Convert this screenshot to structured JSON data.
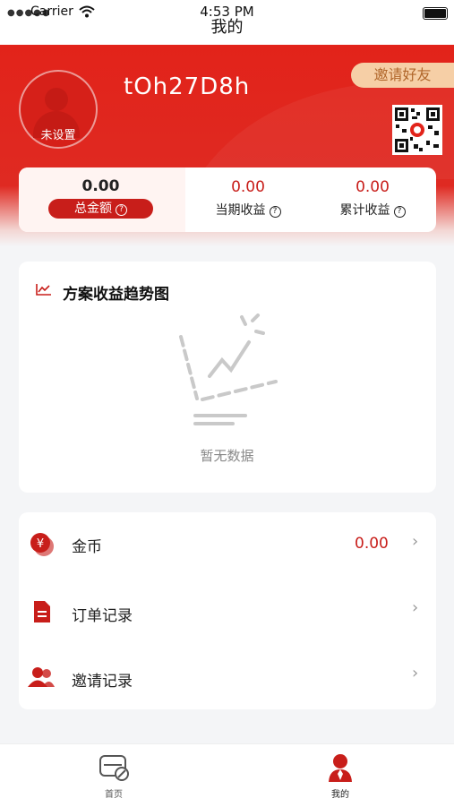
{
  "status_bar": {
    "carrier": "Carrier",
    "time": "4:53 PM"
  },
  "nav": {
    "title": "我的"
  },
  "profile": {
    "avatar_label": "未设置",
    "username": "tOh27D8h",
    "invite_label": "邀请好友"
  },
  "stats": [
    {
      "value": "0.00",
      "label": "总金额"
    },
    {
      "value": "0.00",
      "label": "当期收益"
    },
    {
      "value": "0.00",
      "label": "累计收益"
    }
  ],
  "chart_card": {
    "title": "方案收益趋势图",
    "empty_text": "暂无数据"
  },
  "menu": [
    {
      "label": "金币",
      "value": "0.00",
      "icon": "coin-icon"
    },
    {
      "label": "订单记录",
      "icon": "document-icon"
    },
    {
      "label": "邀请记录",
      "icon": "users-icon"
    }
  ],
  "tabs": [
    {
      "label": "首页",
      "icon": "home-icon"
    },
    {
      "label": "我的",
      "icon": "profile-icon"
    }
  ],
  "colors": {
    "brand": "#e2231a",
    "accent_dark": "#c81e1a",
    "invite_bg": "#f6cfa6"
  }
}
